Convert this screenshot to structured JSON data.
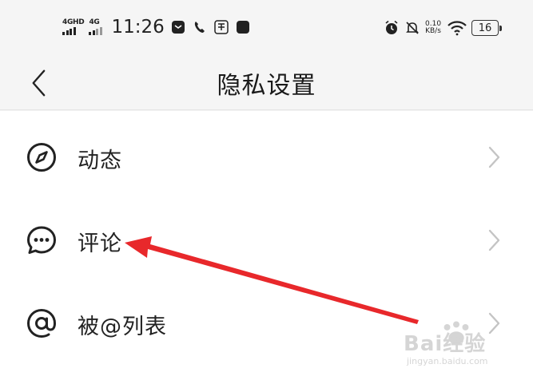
{
  "status_bar": {
    "network_1": "4GHD",
    "network_2": "4G",
    "time": "11:26",
    "speed_value": "0.10",
    "speed_unit": "KB/s",
    "battery": "16",
    "icons": [
      "signal-4ghd-icon",
      "signal-4g-icon",
      "message-app-icon",
      "phone-call-icon",
      "app-icon",
      "app-square-icon",
      "alarm-icon",
      "mute-bell-icon",
      "wifi-icon",
      "battery-icon"
    ]
  },
  "header": {
    "title": "隐私设置",
    "back_icon": "chevron-left-icon"
  },
  "list": {
    "items": [
      {
        "label": "动态",
        "icon": "compass-icon"
      },
      {
        "label": "评论",
        "icon": "comment-bubble-icon"
      },
      {
        "label": "被@列表",
        "icon": "at-sign-icon"
      }
    ],
    "row_action_icon": "chevron-right-icon"
  },
  "annotation": {
    "type": "red-arrow",
    "color": "#e8282b",
    "target": "评论"
  },
  "watermark": {
    "text": "Bai经验",
    "url": "jingyan.baidu.com"
  },
  "colors": {
    "background": "#f2f2f2",
    "text": "#222222",
    "chevron": "#c4c4c4",
    "arrow": "#e8282b"
  }
}
